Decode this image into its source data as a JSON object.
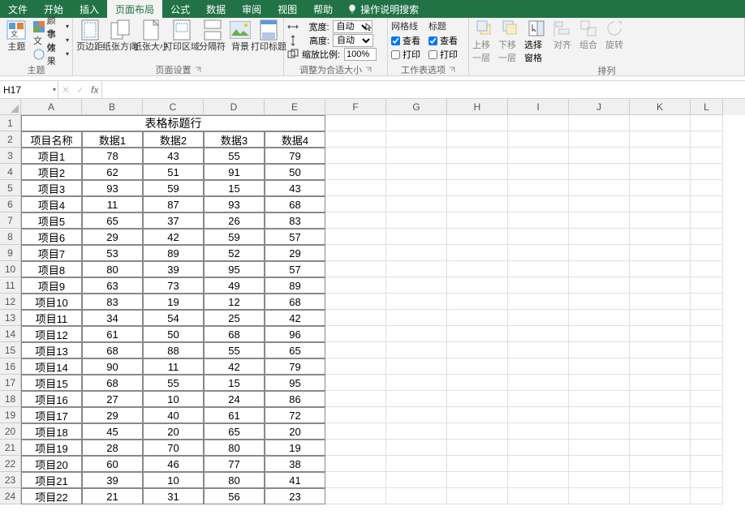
{
  "tabs": {
    "file": "文件",
    "home": "开始",
    "insert": "插入",
    "page_layout": "页面布局",
    "formulas": "公式",
    "data": "数据",
    "review": "审阅",
    "view": "视图",
    "help": "帮助",
    "tell_me": "操作说明搜索"
  },
  "ribbon": {
    "themes": {
      "btn_theme": "主题",
      "colors": "颜色",
      "fonts": "字体",
      "effects": "效果",
      "group": "主题"
    },
    "page_setup": {
      "margins": "页边距",
      "orientation": "纸张方向",
      "size": "纸张大小",
      "print_area": "打印区域",
      "breaks": "分隔符",
      "background": "背景",
      "print_titles": "打印标题",
      "group": "页面设置"
    },
    "scale": {
      "width_lbl": "宽度:",
      "height_lbl": "高度:",
      "auto": "自动",
      "scale_lbl": "缩放比例:",
      "scale_val": "100%",
      "group": "调整为合适大小"
    },
    "sheet_opts": {
      "gridlines": "网格线",
      "headings": "标题",
      "view": "查看",
      "print": "打印",
      "group": "工作表选项"
    },
    "arrange": {
      "bring_forward": "上移一层",
      "send_backward": "下移一层",
      "selection_pane": "选择窗格",
      "align": "对齐",
      "group_btn": "组合",
      "rotate": "旋转",
      "group": "排列"
    }
  },
  "name_box": "H17",
  "columns": [
    "A",
    "B",
    "C",
    "D",
    "E",
    "F",
    "G",
    "H",
    "I",
    "J",
    "K",
    "L"
  ],
  "sheet": {
    "title": "表格标题行",
    "headers": [
      "项目名称",
      "数据1",
      "数据2",
      "数据3",
      "数据4"
    ],
    "rows": [
      {
        "n": "项目1",
        "v": [
          78,
          43,
          55,
          79
        ]
      },
      {
        "n": "项目2",
        "v": [
          62,
          51,
          91,
          50
        ]
      },
      {
        "n": "项目3",
        "v": [
          93,
          59,
          15,
          43
        ]
      },
      {
        "n": "项目4",
        "v": [
          11,
          87,
          93,
          68
        ]
      },
      {
        "n": "项目5",
        "v": [
          65,
          37,
          26,
          83
        ]
      },
      {
        "n": "项目6",
        "v": [
          29,
          42,
          59,
          57
        ]
      },
      {
        "n": "项目7",
        "v": [
          53,
          89,
          52,
          29
        ]
      },
      {
        "n": "项目8",
        "v": [
          80,
          39,
          95,
          57
        ]
      },
      {
        "n": "项目9",
        "v": [
          63,
          73,
          49,
          89
        ]
      },
      {
        "n": "项目10",
        "v": [
          83,
          19,
          12,
          68
        ]
      },
      {
        "n": "项目11",
        "v": [
          34,
          54,
          25,
          42
        ]
      },
      {
        "n": "项目12",
        "v": [
          61,
          50,
          68,
          96
        ]
      },
      {
        "n": "项目13",
        "v": [
          68,
          88,
          55,
          65
        ]
      },
      {
        "n": "项目14",
        "v": [
          90,
          11,
          42,
          79
        ]
      },
      {
        "n": "项目15",
        "v": [
          68,
          55,
          15,
          95
        ]
      },
      {
        "n": "项目16",
        "v": [
          27,
          10,
          24,
          86
        ]
      },
      {
        "n": "项目17",
        "v": [
          29,
          40,
          61,
          72
        ]
      },
      {
        "n": "项目18",
        "v": [
          45,
          20,
          65,
          20
        ]
      },
      {
        "n": "项目19",
        "v": [
          28,
          70,
          80,
          19
        ]
      },
      {
        "n": "项目20",
        "v": [
          60,
          46,
          77,
          38
        ]
      },
      {
        "n": "项目21",
        "v": [
          39,
          10,
          80,
          41
        ]
      },
      {
        "n": "项目22",
        "v": [
          21,
          31,
          56,
          23
        ]
      }
    ]
  }
}
